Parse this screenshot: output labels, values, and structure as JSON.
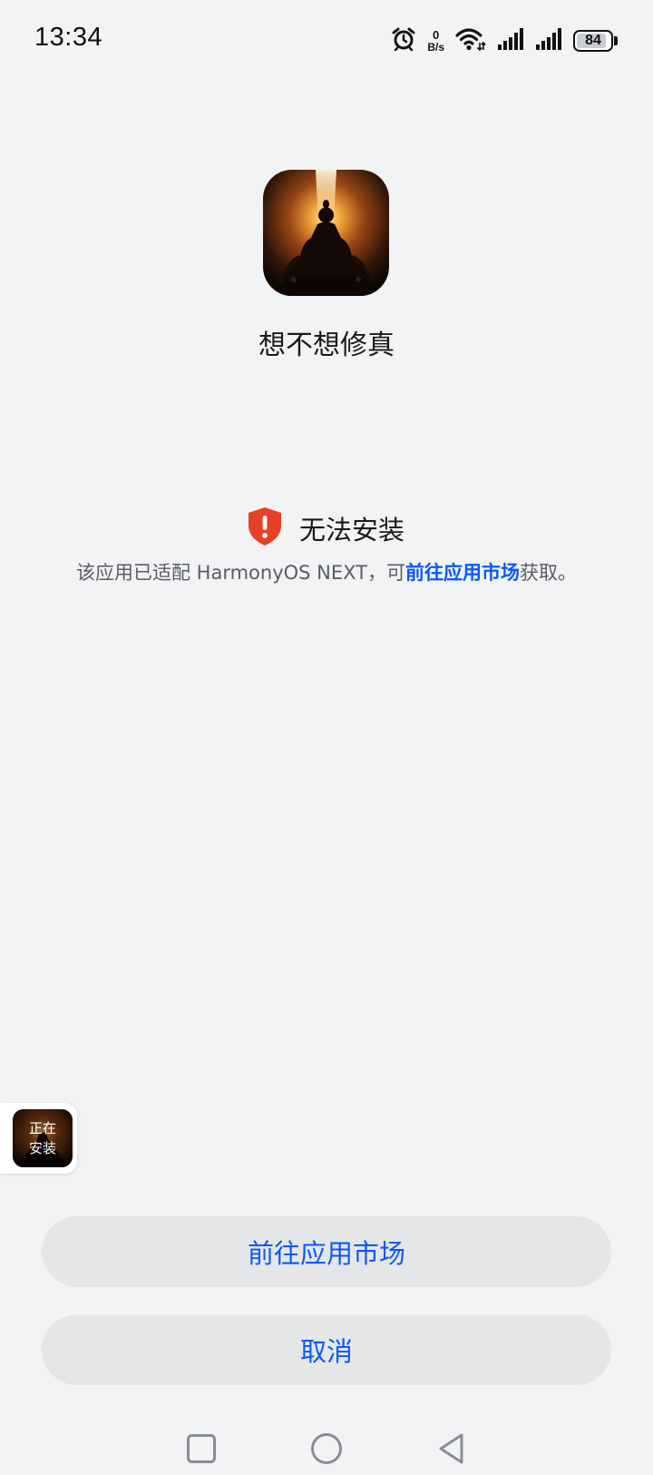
{
  "status_bar": {
    "time": "13:34",
    "net_speed_value": "0",
    "net_speed_unit": "B/s",
    "battery_level": "84",
    "icons": [
      "alarm-icon",
      "wifi-icon",
      "signal-icon",
      "signal-icon"
    ]
  },
  "app": {
    "name": "想不想修真",
    "icon": "meditating-cultivator-icon"
  },
  "warning": {
    "title": "无法安装",
    "desc_prefix": "该应用已适配 HarmonyOS NEXT，可",
    "desc_link": "前往应用市场",
    "desc_suffix": "获取。",
    "icon": "shield-exclamation-icon",
    "color": "#e84026"
  },
  "installing": {
    "label_line1": "正在",
    "label_line2": "安装"
  },
  "buttons": {
    "market_label": "前往应用市场",
    "cancel_label": "取消"
  },
  "nav": {
    "items": [
      "recents-square-icon",
      "home-circle-icon",
      "back-triangle-icon"
    ]
  },
  "colors": {
    "accent": "#0a59f7",
    "background": "#f1f3f5",
    "button_bg": "#e5e6e8"
  }
}
